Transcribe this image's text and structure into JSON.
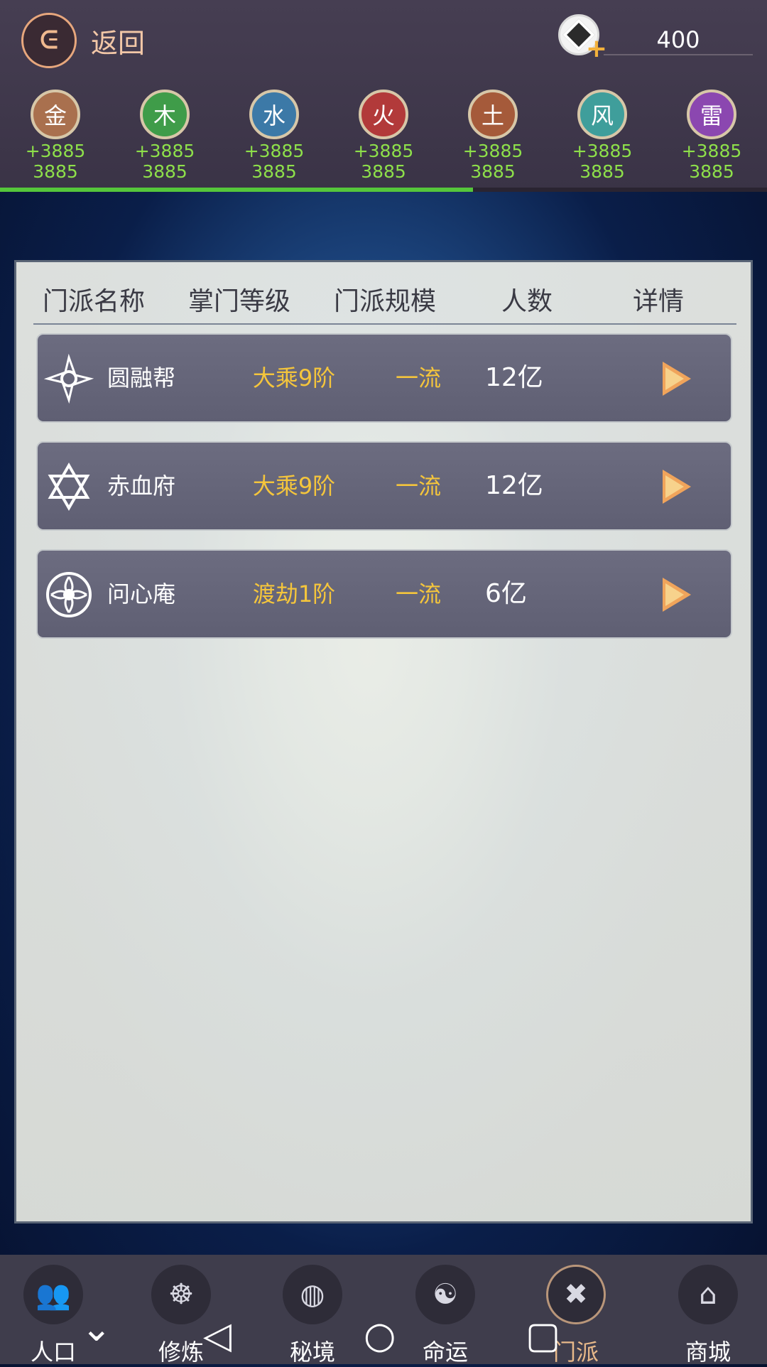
{
  "top": {
    "back_icon": "back-arrow-icon",
    "back_label": "返回",
    "currency_icon": "coin-plus-icon",
    "currency_value": "400",
    "elements": [
      {
        "name": "金",
        "bonus": "+3885",
        "value": "3885",
        "color": "#a9704e"
      },
      {
        "name": "木",
        "bonus": "+3885",
        "value": "3885",
        "color": "#3f9c49"
      },
      {
        "name": "水",
        "bonus": "+3885",
        "value": "3885",
        "color": "#3c79a7"
      },
      {
        "name": "火",
        "bonus": "+3885",
        "value": "3885",
        "color": "#b23a3a"
      },
      {
        "name": "土",
        "bonus": "+3885",
        "value": "3885",
        "color": "#a55a3a"
      },
      {
        "name": "风",
        "bonus": "+3885",
        "value": "3885",
        "color": "#3f9e9b"
      },
      {
        "name": "雷",
        "bonus": "+3885",
        "value": "3885",
        "color": "#8b47b0"
      }
    ],
    "progress": 0.617
  },
  "table": {
    "headers": [
      "门派名称",
      "掌门等级",
      "门派规模",
      "人数",
      "详情"
    ],
    "rows": [
      {
        "name": "圆融帮",
        "level": "大乘9阶",
        "scale": "一流",
        "count": "12亿",
        "emblem": "shuriken-emblem-icon"
      },
      {
        "name": "赤血府",
        "level": "大乘9阶",
        "scale": "一流",
        "count": "12亿",
        "emblem": "hexagram-emblem-icon"
      },
      {
        "name": "问心庵",
        "level": "渡劫1阶",
        "scale": "一流",
        "count": "6亿",
        "emblem": "lotus-emblem-icon"
      }
    ]
  },
  "tabs": [
    {
      "label": "人口",
      "icon": "people-icon"
    },
    {
      "label": "修炼",
      "icon": "meditation-icon"
    },
    {
      "label": "秘境",
      "icon": "globe-icon"
    },
    {
      "label": "命运",
      "icon": "yin-yang-icon"
    },
    {
      "label": "门派",
      "icon": "sect-book-icon",
      "active": true
    },
    {
      "label": "商城",
      "icon": "shop-icon"
    }
  ],
  "navbar": [
    "chevron-down-icon",
    "back-triangle-icon",
    "home-circle-icon",
    "recents-square-icon"
  ]
}
